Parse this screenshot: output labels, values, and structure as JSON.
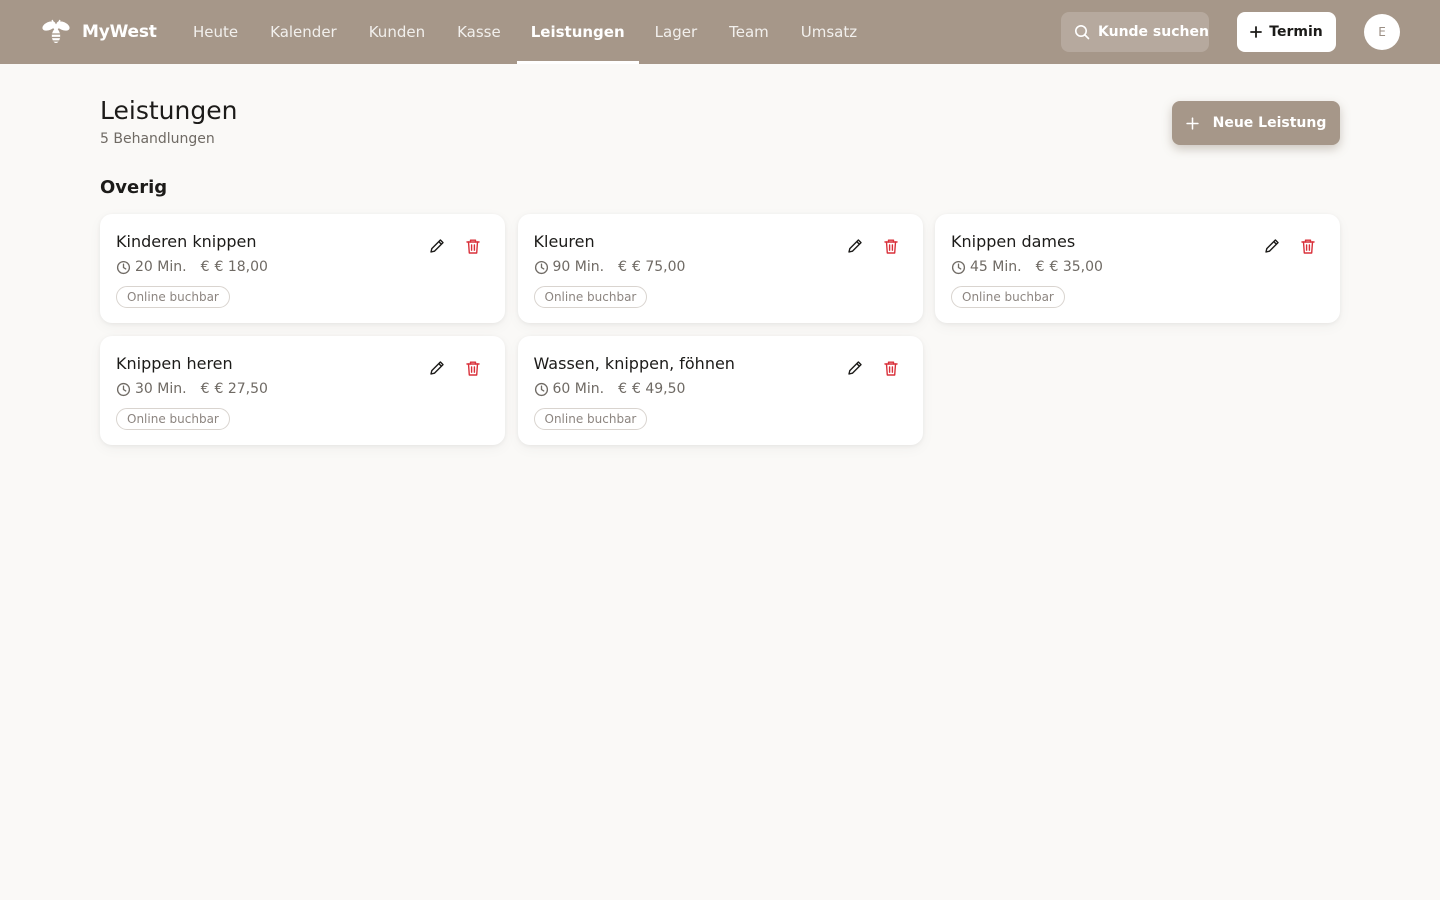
{
  "app": {
    "brand": "MyWest",
    "brand_icon": "bee-icon",
    "accent_color": "#a69789",
    "danger_color": "#d9303a"
  },
  "nav": {
    "items": [
      {
        "label": "Heute",
        "active": false
      },
      {
        "label": "Kalender",
        "active": false
      },
      {
        "label": "Kunden",
        "active": false
      },
      {
        "label": "Kasse",
        "active": false
      },
      {
        "label": "Leistungen",
        "active": true
      },
      {
        "label": "Lager",
        "active": false
      },
      {
        "label": "Team",
        "active": false
      },
      {
        "label": "Umsatz",
        "active": false
      }
    ]
  },
  "header_actions": {
    "search_label": "Kunde suchen",
    "search_icon": "search-icon",
    "termin_label": "Termin",
    "termin_icon": "plus-icon",
    "avatar_initial": "E"
  },
  "page": {
    "title": "Leistungen",
    "subtitle": "5 Behandlungen",
    "new_button_label": "Neue Leistung",
    "new_button_icon": "plus-icon"
  },
  "category": {
    "title": "Overig",
    "services": [
      {
        "name": "Kinderen knippen",
        "duration": "20 Min.",
        "currency_icon": "€",
        "price": "€ 18,00",
        "badge": "Online buchbar"
      },
      {
        "name": "Kleuren",
        "duration": "90 Min.",
        "currency_icon": "€",
        "price": "€ 75,00",
        "badge": "Online buchbar"
      },
      {
        "name": "Knippen dames",
        "duration": "45 Min.",
        "currency_icon": "€",
        "price": "€ 35,00",
        "badge": "Online buchbar"
      },
      {
        "name": "Knippen heren",
        "duration": "30 Min.",
        "currency_icon": "€",
        "price": "€ 27,50",
        "badge": "Online buchbar"
      },
      {
        "name": "Wassen, knippen, föhnen",
        "duration": "60 Min.",
        "currency_icon": "€",
        "price": "€ 49,50",
        "badge": "Online buchbar"
      }
    ]
  }
}
